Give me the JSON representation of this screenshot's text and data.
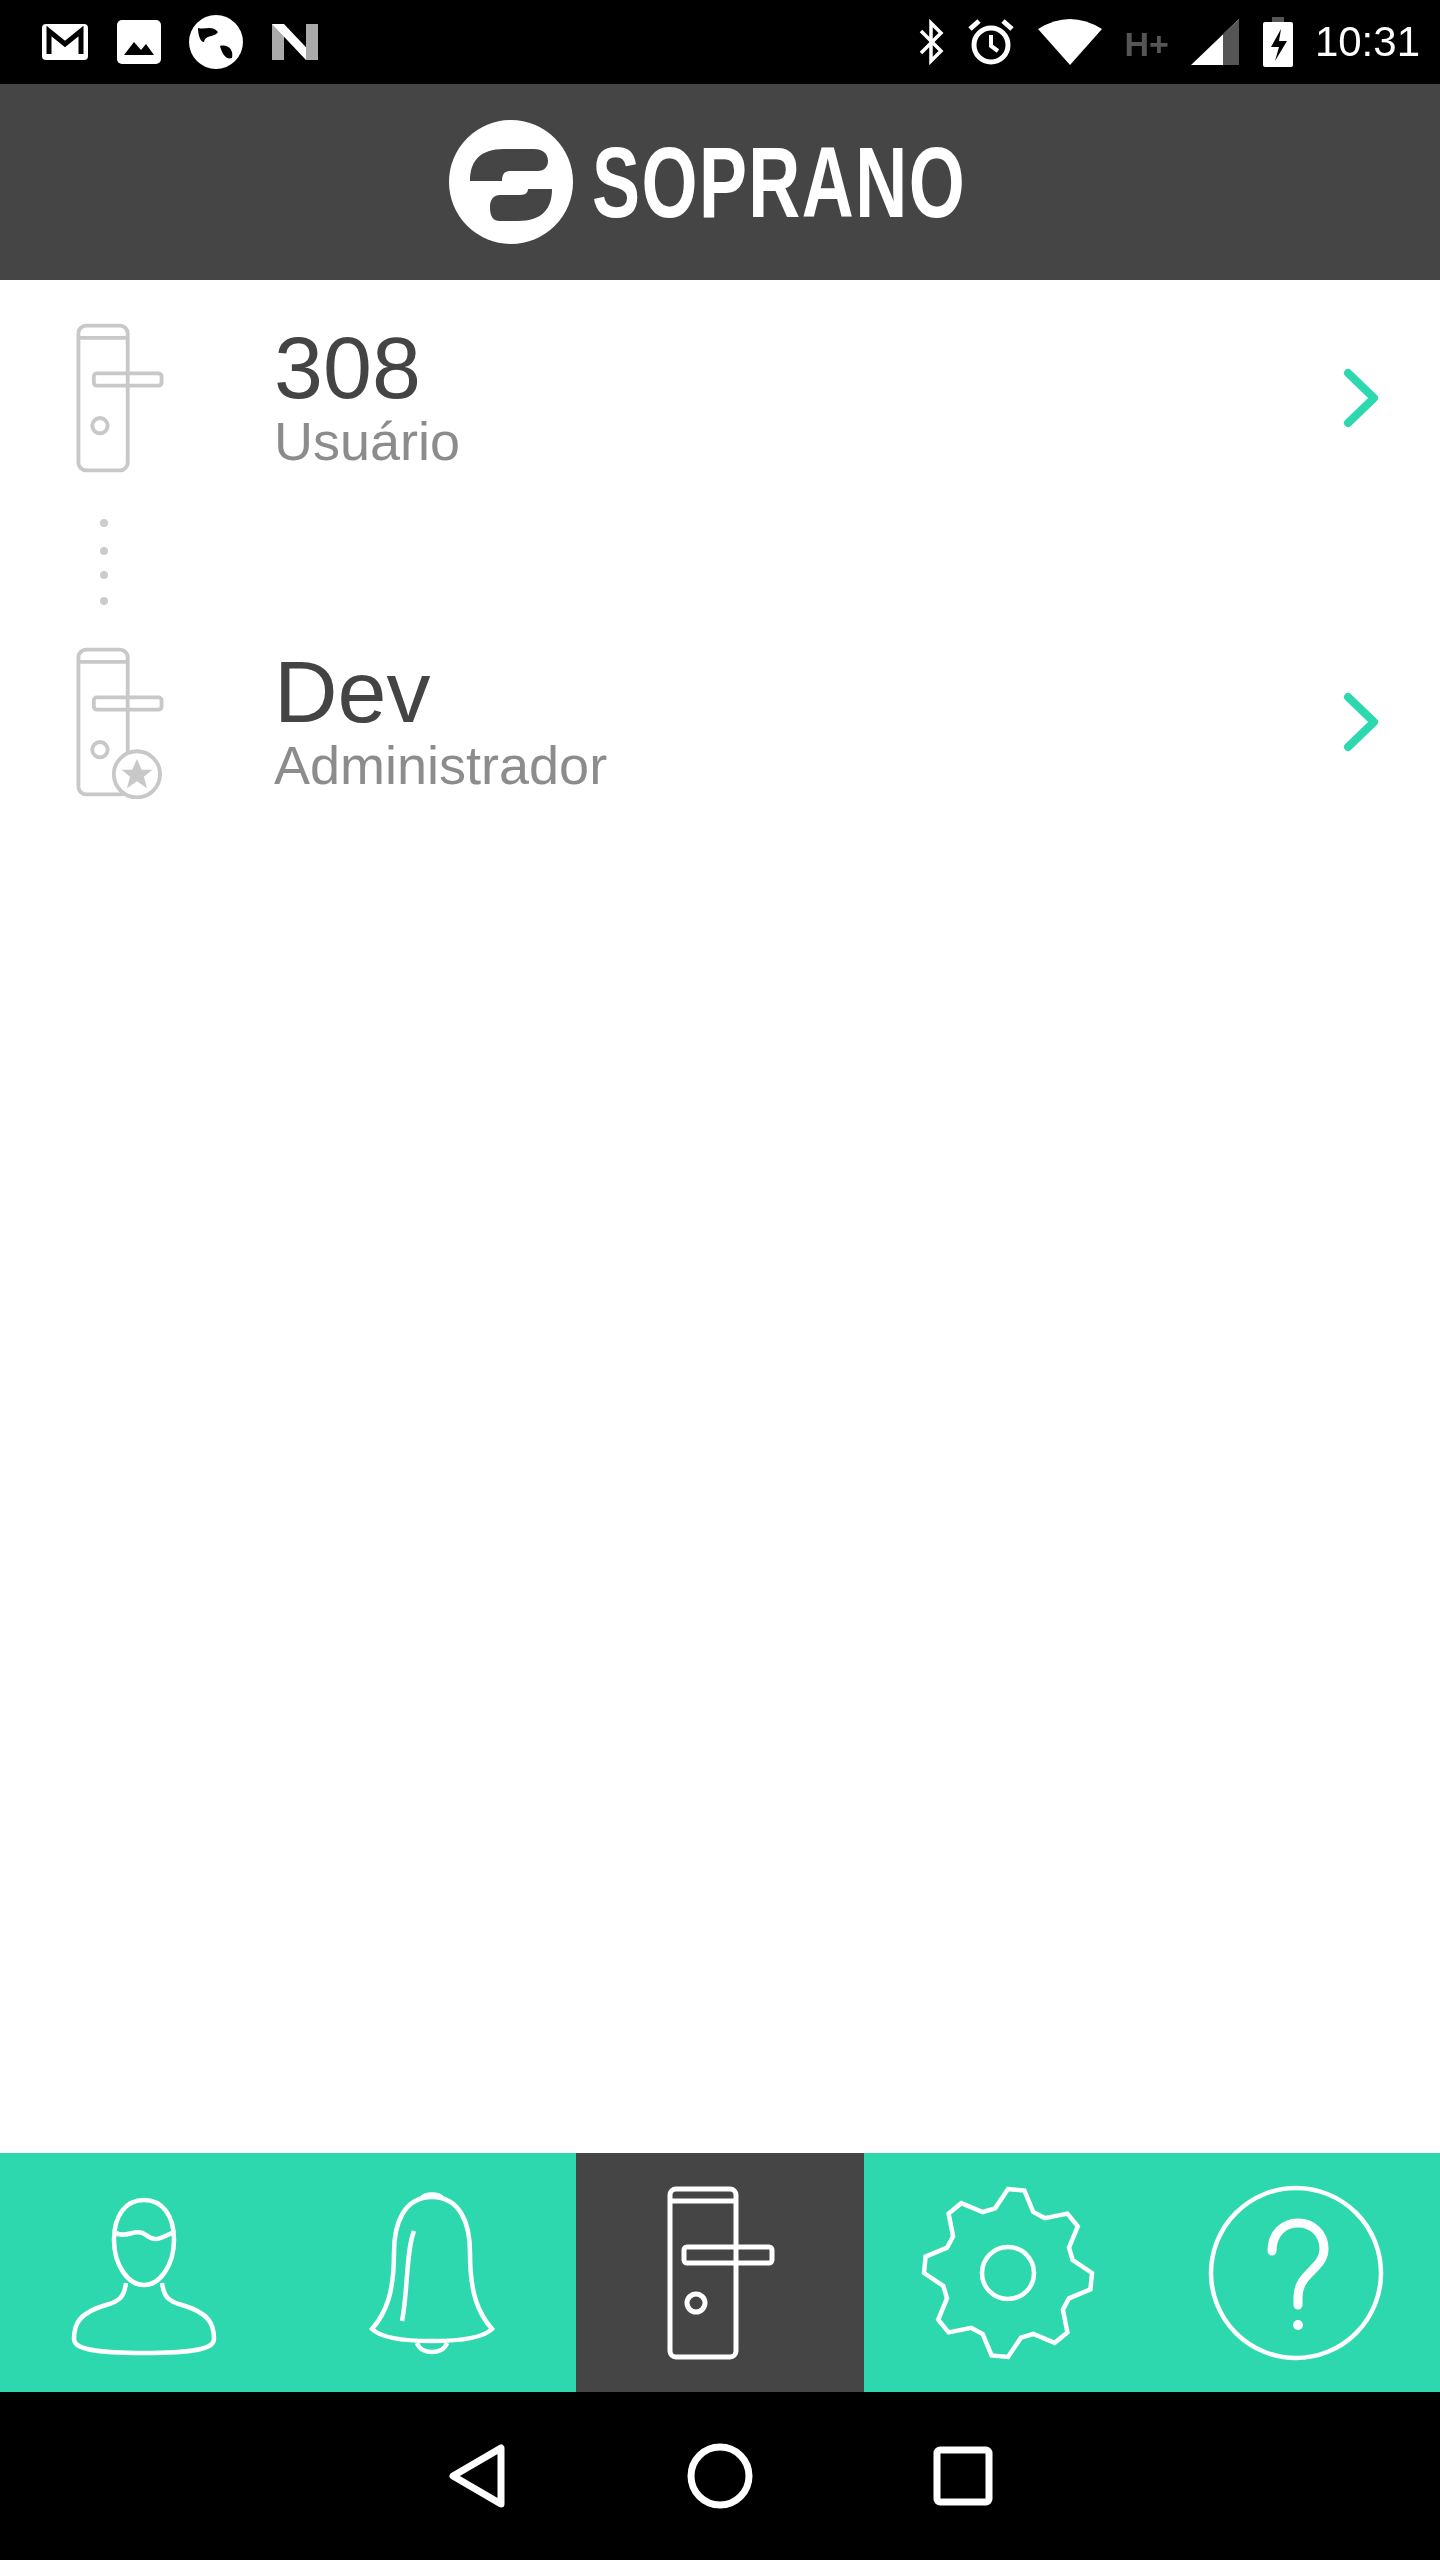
{
  "status_bar": {
    "network": "H+",
    "time": "10:31"
  },
  "header": {
    "logo_text": "SOPRANO"
  },
  "locks": [
    {
      "kind": "user",
      "name": "308",
      "role": "Usuário"
    },
    {
      "kind": "admin",
      "name": "Dev",
      "role": "Administrador"
    }
  ],
  "tabs": [
    {
      "kind": "profile",
      "selected": false
    },
    {
      "kind": "notifications",
      "selected": false
    },
    {
      "kind": "locks",
      "selected": true
    },
    {
      "kind": "settings",
      "selected": false
    },
    {
      "kind": "help",
      "selected": false
    }
  ]
}
